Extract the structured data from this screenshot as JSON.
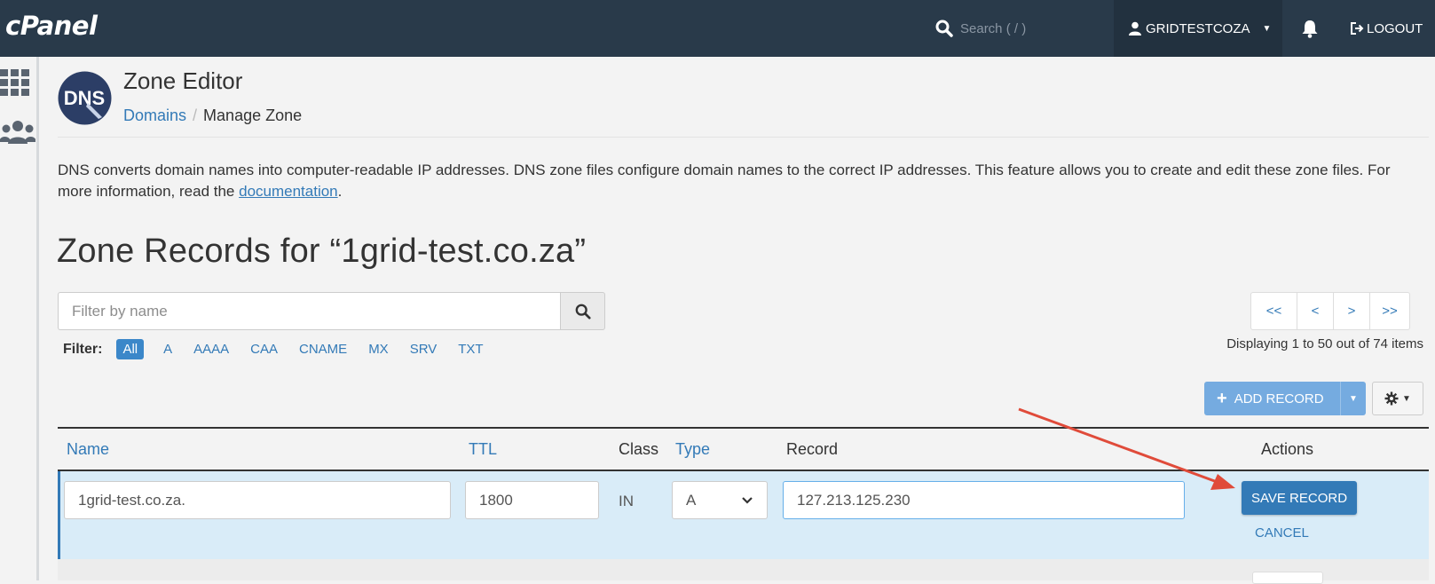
{
  "app": {
    "logo_text": "cPanel"
  },
  "topbar": {
    "search_placeholder": "Search ( / )",
    "username": "GRIDTESTCOZA",
    "logout_label": "LOGOUT"
  },
  "sidebar": {
    "items": [
      {
        "icon": "grid-icon"
      },
      {
        "icon": "users-icon"
      }
    ]
  },
  "header": {
    "logo_text": "DNS",
    "title": "Zone Editor",
    "breadcrumb": {
      "parent": "Domains",
      "separator": "/",
      "current": "Manage Zone"
    }
  },
  "description": {
    "text_before": "DNS converts domain names into computer-readable IP addresses. DNS zone files configure domain names to the correct IP addresses. This feature allows you to create and edit these zone files. For more information, read the ",
    "link": "documentation",
    "text_after": "."
  },
  "zone": {
    "heading": "Zone Records for “1grid-test.co.za”"
  },
  "filter": {
    "placeholder": "Filter by name",
    "label": "Filter:",
    "types": [
      "All",
      "A",
      "AAAA",
      "CAA",
      "CNAME",
      "MX",
      "SRV",
      "TXT"
    ],
    "active": "All"
  },
  "pagination": {
    "first": "<<",
    "prev": "<",
    "next": ">",
    "last": ">>",
    "display_text": "Displaying 1 to 50 out of 74 items"
  },
  "actions": {
    "add_record_label": "ADD RECORD"
  },
  "table": {
    "headers": {
      "name": "Name",
      "ttl": "TTL",
      "class": "Class",
      "type": "Type",
      "record": "Record",
      "actions": "Actions"
    },
    "edit_row": {
      "name": "1grid-test.co.za.",
      "ttl": "1800",
      "class": "IN",
      "type": "A",
      "record": "127.213.125.230",
      "save_label": "SAVE RECORD",
      "cancel_label": "CANCEL"
    }
  },
  "colors": {
    "topbar": "#293a4a",
    "link": "#337ab7",
    "edit_row": "#d9ecf8",
    "annotation_arrow": "#e04b3a"
  }
}
